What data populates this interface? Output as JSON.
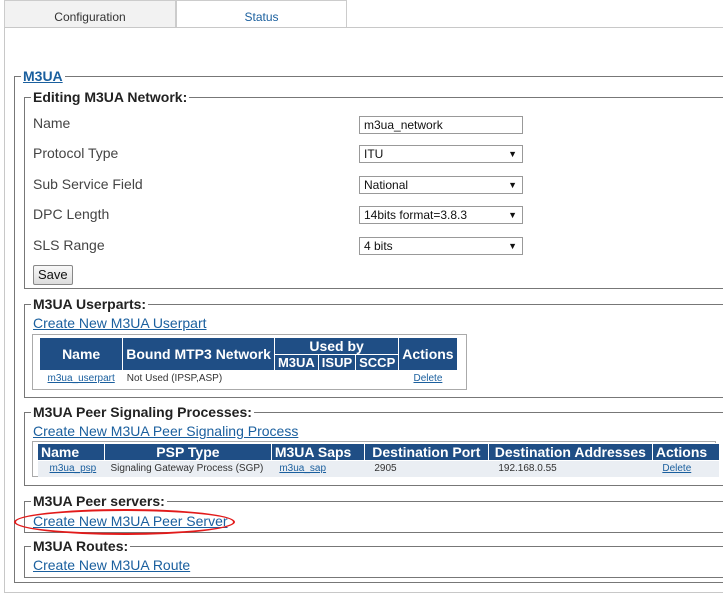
{
  "tabs": [
    {
      "label": "Configuration"
    },
    {
      "label": "Status"
    }
  ],
  "m3ua": {
    "legend": "M3UA"
  },
  "network": {
    "legend": "Editing M3UA Network:",
    "fields": {
      "name": {
        "label": "Name",
        "value": "m3ua_network"
      },
      "protocol": {
        "label": "Protocol Type",
        "value": "ITU"
      },
      "ssf": {
        "label": "Sub Service Field",
        "value": "National"
      },
      "dpc": {
        "label": "DPC Length",
        "value": "14bits format=3.8.3"
      },
      "sls": {
        "label": "SLS Range",
        "value": "4 bits"
      }
    },
    "save_label": "Save"
  },
  "userparts": {
    "legend": "M3UA Userparts:",
    "create_link": "Create New M3UA Userpart",
    "headers": {
      "name": "Name",
      "bound": "Bound MTP3 Network",
      "used_by": "Used by",
      "m3ua": "M3UA",
      "isup": "ISUP",
      "sccp": "SCCP",
      "actions": "Actions"
    },
    "rows": [
      {
        "name": "m3ua_userpart",
        "bound": "Not Used (IPSP,ASP)",
        "action": "Delete"
      }
    ]
  },
  "psp": {
    "legend": "M3UA Peer Signaling Processes:",
    "create_link": "Create New M3UA Peer Signaling Process",
    "headers": {
      "name": "Name",
      "type": "PSP Type",
      "saps": "M3UA Saps",
      "port": "Destination Port",
      "addresses": "Destination Addresses",
      "actions": "Actions"
    },
    "rows": [
      {
        "name": "m3ua_psp",
        "type": "Signaling Gateway Process (SGP)",
        "saps": "m3ua_sap",
        "port": "2905",
        "addresses": "192.168.0.55",
        "action": "Delete"
      }
    ]
  },
  "peer_servers": {
    "legend": "M3UA Peer servers:",
    "create_link": "Create New M3UA Peer Server"
  },
  "routes": {
    "legend": "M3UA Routes:",
    "create_link": "Create New M3UA Route"
  },
  "colors": {
    "header_bg": "#1f4e85",
    "link": "#1a5f9e",
    "highlight": "#e21a1a"
  }
}
